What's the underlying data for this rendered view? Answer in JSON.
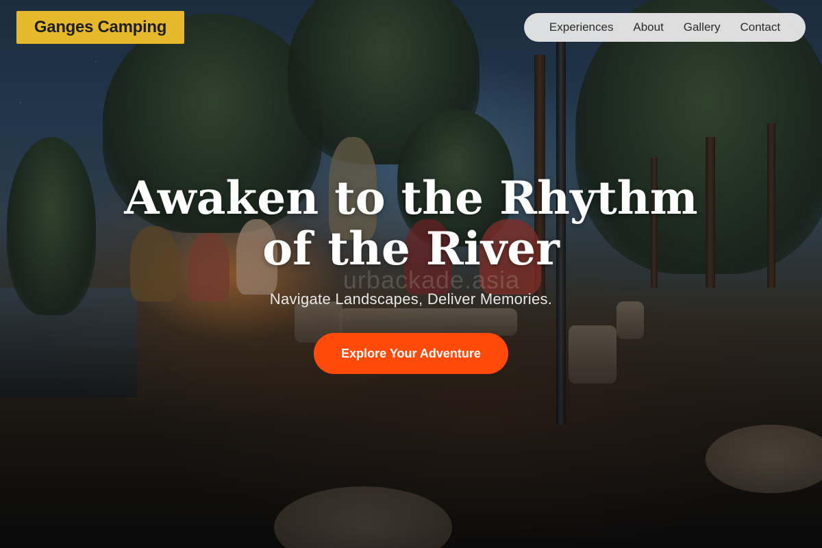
{
  "header": {
    "logo_text": "Ganges Camping",
    "nav": [
      {
        "label": "Experiences"
      },
      {
        "label": "About"
      },
      {
        "label": "Gallery"
      },
      {
        "label": "Contact"
      }
    ]
  },
  "hero": {
    "title": "Awaken to the Rhythm of the River",
    "watermark": "urbackade.asia",
    "subtitle": "Navigate Landscapes, Deliver Memories.",
    "cta_label": "Explore Your Adventure",
    "background": "campfire-at-night-lakeside-forest"
  },
  "colors": {
    "logo_bg": "#e6b82c",
    "nav_bg": "#ececec",
    "cta_bg": "#ff4a0a",
    "text_light": "#ffffff"
  }
}
